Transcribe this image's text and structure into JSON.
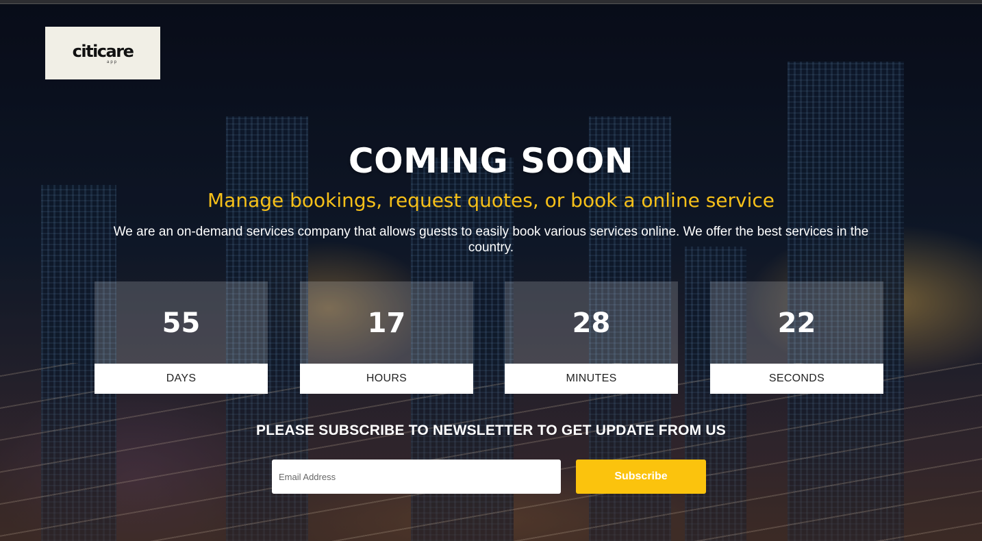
{
  "logo": {
    "brand": "citicare",
    "sub": "app"
  },
  "hero": {
    "title": "COMING SOON",
    "tagline": "Manage bookings, request quotes, or book a online service",
    "description": "We are an on-demand services company that allows guests to easily book various services online. We offer the best services in the country."
  },
  "countdown": [
    {
      "value": "55",
      "label": "DAYS"
    },
    {
      "value": "17",
      "label": "HOURS"
    },
    {
      "value": "28",
      "label": "MINUTES"
    },
    {
      "value": "22",
      "label": "SECONDS"
    }
  ],
  "newsletter": {
    "heading": "PLEASE SUBSCRIBE TO NEWSLETTER TO GET UPDATE FROM US",
    "email_placeholder": "Email Address",
    "email_value": "",
    "button_label": "Subscribe"
  },
  "colors": {
    "accent": "#fbc30d",
    "tagline": "#f6c019",
    "text": "#ffffff"
  }
}
